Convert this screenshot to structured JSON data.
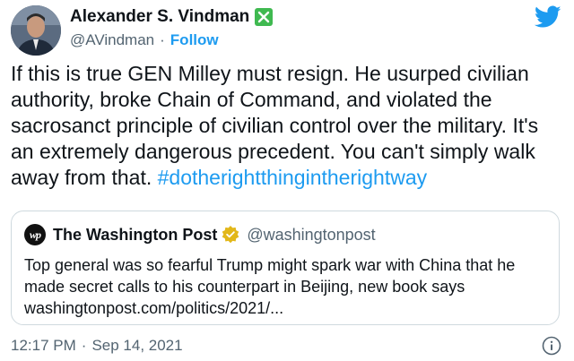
{
  "author": {
    "display_name": "Alexander S. Vindman",
    "handle": "@AVindman",
    "separator": "·",
    "follow_label": "Follow"
  },
  "tweet": {
    "text": "If this is true GEN Milley must resign. He usurped civilian authority, broke Chain of Command, and violated the sacrosanct principle of civilian control over the military. It's an extremely dangerous precedent. You can't simply walk away from that. ",
    "hashtag": "#dotherightthingintherightway"
  },
  "quote": {
    "logo_text": "wp",
    "name": "The Washington Post",
    "handle": "@washingtonpost",
    "text": "Top general was so fearful Trump might spark war with China that he made secret calls to his counterpart in Beijing, new book says washingtonpost.com/politics/2021/..."
  },
  "footer": {
    "time": "12:17 PM",
    "separator": "·",
    "date": "Sep 14, 2021"
  },
  "colors": {
    "accent": "#1d9bf0",
    "verified_green": "#3fb950",
    "gold_badge": "#e2b719",
    "muted": "#536471"
  },
  "icons": [
    "avatar",
    "verified-icon",
    "twitter-bird-icon",
    "washington-post-logo",
    "gold-verified-icon",
    "info-icon"
  ]
}
